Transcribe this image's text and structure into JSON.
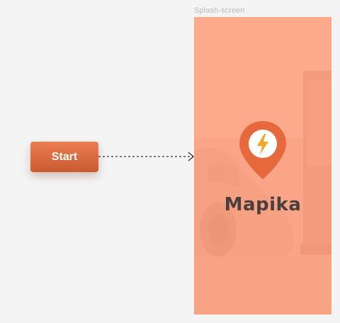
{
  "frame": {
    "label": "Splash-screen"
  },
  "start_button": {
    "label": "Start"
  },
  "splash": {
    "brand_name": "Mapika",
    "logo_icon": "map-pin-lightning-bolt-icon"
  },
  "colors": {
    "canvas_bg": "#f4f4f4",
    "frame_overlay": "#ffa080",
    "brand_orange": "#e5693c",
    "bolt_yellow": "#f5a623",
    "brand_text": "#4a3f3c"
  }
}
